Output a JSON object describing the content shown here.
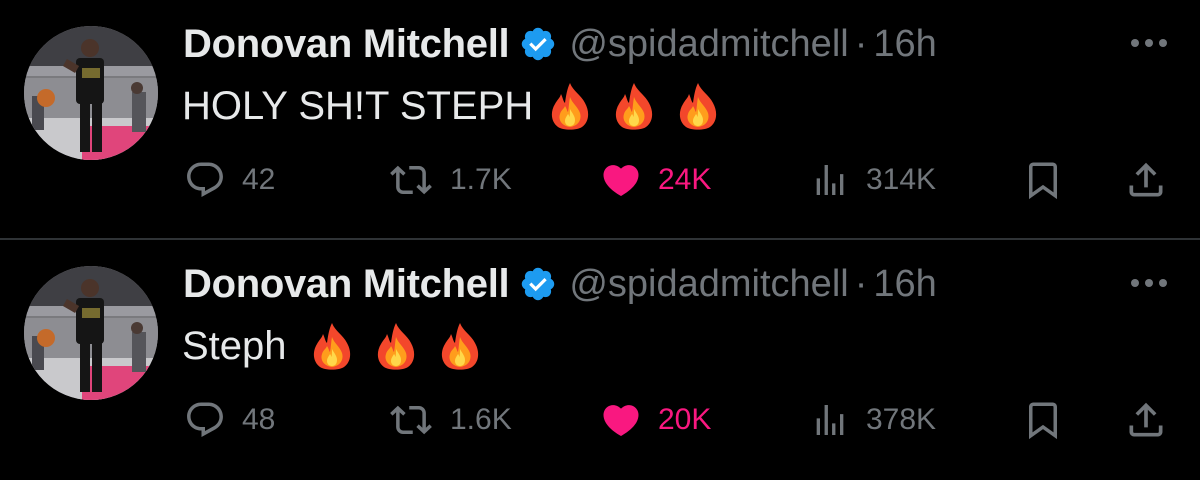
{
  "tweets": [
    {
      "author": {
        "name": "Donovan Mitchell",
        "handle": "@spidadmitchell",
        "separator": "·",
        "time": "16h",
        "verified": true,
        "avatar_icon": "player-avatar"
      },
      "text": "HOLY SH!T STEPH",
      "emojis": [
        "fire-emoji",
        "fire-emoji",
        "fire-emoji"
      ],
      "stats": {
        "replies": "42",
        "retweets": "1.7K",
        "likes": "24K",
        "views": "314K"
      },
      "liked": true
    },
    {
      "author": {
        "name": "Donovan Mitchell",
        "handle": "@spidadmitchell",
        "separator": "·",
        "time": "16h",
        "verified": true,
        "avatar_icon": "player-avatar"
      },
      "text": "Steph",
      "emojis": [
        "fire-emoji",
        "fire-emoji",
        "fire-emoji"
      ],
      "stats": {
        "replies": "48",
        "retweets": "1.6K",
        "likes": "20K",
        "views": "378K"
      },
      "liked": true
    }
  ],
  "colors": {
    "background": "#000000",
    "primary_text": "#e7e9ea",
    "secondary_text": "#71767b",
    "like_accent": "#f91880",
    "verified_badge": "#1d9bf0",
    "divider": "#2f3336"
  }
}
